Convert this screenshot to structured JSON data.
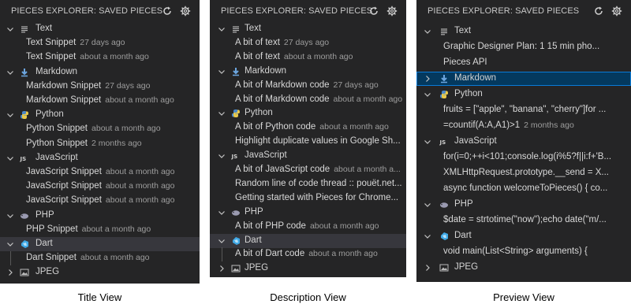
{
  "header_title": "PIECES EXPLORER: SAVED PIECES",
  "icons": [
    "refresh-icon",
    "gear-icon",
    "chevron-down-icon",
    "chevron-right-icon",
    "text-icon",
    "markdown-icon",
    "python-icon",
    "js-icon",
    "php-icon",
    "dart-icon",
    "image-icon"
  ],
  "title_view": {
    "caption": "Title View",
    "groups": [
      {
        "label": "Text",
        "icon": "text",
        "expanded": true,
        "items": [
          {
            "title": "Text Snippet",
            "time": "27 days ago"
          },
          {
            "title": "Text Snippet",
            "time": "about a month ago"
          }
        ]
      },
      {
        "label": "Markdown",
        "icon": "markdown",
        "expanded": true,
        "items": [
          {
            "title": "Markdown Snippet",
            "time": "27 days ago"
          },
          {
            "title": "Markdown Snippet",
            "time": "about a month ago"
          }
        ]
      },
      {
        "label": "Python",
        "icon": "python",
        "expanded": true,
        "items": [
          {
            "title": "Python Snippet",
            "time": "about a month ago"
          },
          {
            "title": "Python Snippet",
            "time": "2 months ago"
          }
        ]
      },
      {
        "label": "JavaScript",
        "icon": "js",
        "expanded": true,
        "items": [
          {
            "title": "JavaScript Snippet",
            "time": "about a month ago"
          },
          {
            "title": "JavaScript Snippet",
            "time": "about a month ago"
          },
          {
            "title": "JavaScript Snippet",
            "time": "about a month ago"
          }
        ]
      },
      {
        "label": "PHP",
        "icon": "php",
        "expanded": true,
        "items": [
          {
            "title": "PHP Snippet",
            "time": "about a month ago"
          }
        ]
      },
      {
        "label": "Dart",
        "icon": "dart",
        "expanded": true,
        "selected": true,
        "items": [
          {
            "title": "Dart Snippet",
            "time": "about a month ago"
          }
        ]
      },
      {
        "label": "JPEG",
        "icon": "image",
        "expanded": false,
        "items": []
      }
    ]
  },
  "description_view": {
    "caption": "Description View",
    "groups": [
      {
        "label": "Text",
        "icon": "text",
        "expanded": true,
        "items": [
          {
            "title": "A bit of text",
            "time": "27 days ago"
          },
          {
            "title": "A bit of text",
            "time": "about a month ago"
          }
        ]
      },
      {
        "label": "Markdown",
        "icon": "markdown",
        "expanded": true,
        "items": [
          {
            "title": "A bit of Markdown code",
            "time": "27 days ago"
          },
          {
            "title": "A bit of Markdown code",
            "time": "about a month ago"
          }
        ]
      },
      {
        "label": "Python",
        "icon": "python",
        "expanded": true,
        "items": [
          {
            "title": "A bit of Python code",
            "time": "about a month ago"
          },
          {
            "title": "Highlight duplicate values in Google Sh...",
            "time": ""
          }
        ]
      },
      {
        "label": "JavaScript",
        "icon": "js",
        "expanded": true,
        "items": [
          {
            "title": "A bit of JavaScript code",
            "time": "about a month a..."
          },
          {
            "title": "Random line of code thread :: pouët.net...",
            "time": ""
          },
          {
            "title": "Getting started with Pieces for Chrome...",
            "time": ""
          }
        ]
      },
      {
        "label": "PHP",
        "icon": "php",
        "expanded": true,
        "items": [
          {
            "title": "A bit of PHP code",
            "time": "about a month ago"
          }
        ]
      },
      {
        "label": "Dart",
        "icon": "dart",
        "expanded": true,
        "selected": true,
        "items": [
          {
            "title": "A bit of Dart code",
            "time": "about a month ago"
          }
        ]
      },
      {
        "label": "JPEG",
        "icon": "image",
        "expanded": false,
        "items": []
      }
    ]
  },
  "preview_view": {
    "caption": "Preview View",
    "groups": [
      {
        "label": "Text",
        "icon": "text",
        "expanded": true,
        "items": [
          {
            "title": "Graphic Designer Plan:  1       15 min pho...",
            "time": ""
          },
          {
            "title": "Pieces API",
            "time": ""
          }
        ]
      },
      {
        "label": "Markdown",
        "icon": "markdown",
        "expanded": false,
        "highlighted": true,
        "items": []
      },
      {
        "label": "Python",
        "icon": "python",
        "expanded": true,
        "items": [
          {
            "title": "fruits = [\"apple\", \"banana\", \"cherry\"]for ...",
            "time": ""
          },
          {
            "title": "=countif(A:A,A1)>1",
            "time": "2 months ago"
          }
        ]
      },
      {
        "label": "JavaScript",
        "icon": "js",
        "expanded": true,
        "items": [
          {
            "title": "for(i=0;++i<101;console.log(i%5?f||i:f+'B...",
            "time": ""
          },
          {
            "title": "XMLHttpRequest.prototype.__send = X...",
            "time": ""
          },
          {
            "title": "async function welcomeToPieces() {  co...",
            "time": ""
          }
        ]
      },
      {
        "label": "PHP",
        "icon": "php",
        "expanded": true,
        "items": [
          {
            "title": "$date = strtotime(\"now\");echo date(\"m/...",
            "time": ""
          }
        ]
      },
      {
        "label": "Dart",
        "icon": "dart",
        "expanded": true,
        "items": [
          {
            "title": "void main(List<String> arguments) {",
            "time": ""
          }
        ]
      },
      {
        "label": "JPEG",
        "icon": "image",
        "expanded": false,
        "items": []
      }
    ]
  }
}
